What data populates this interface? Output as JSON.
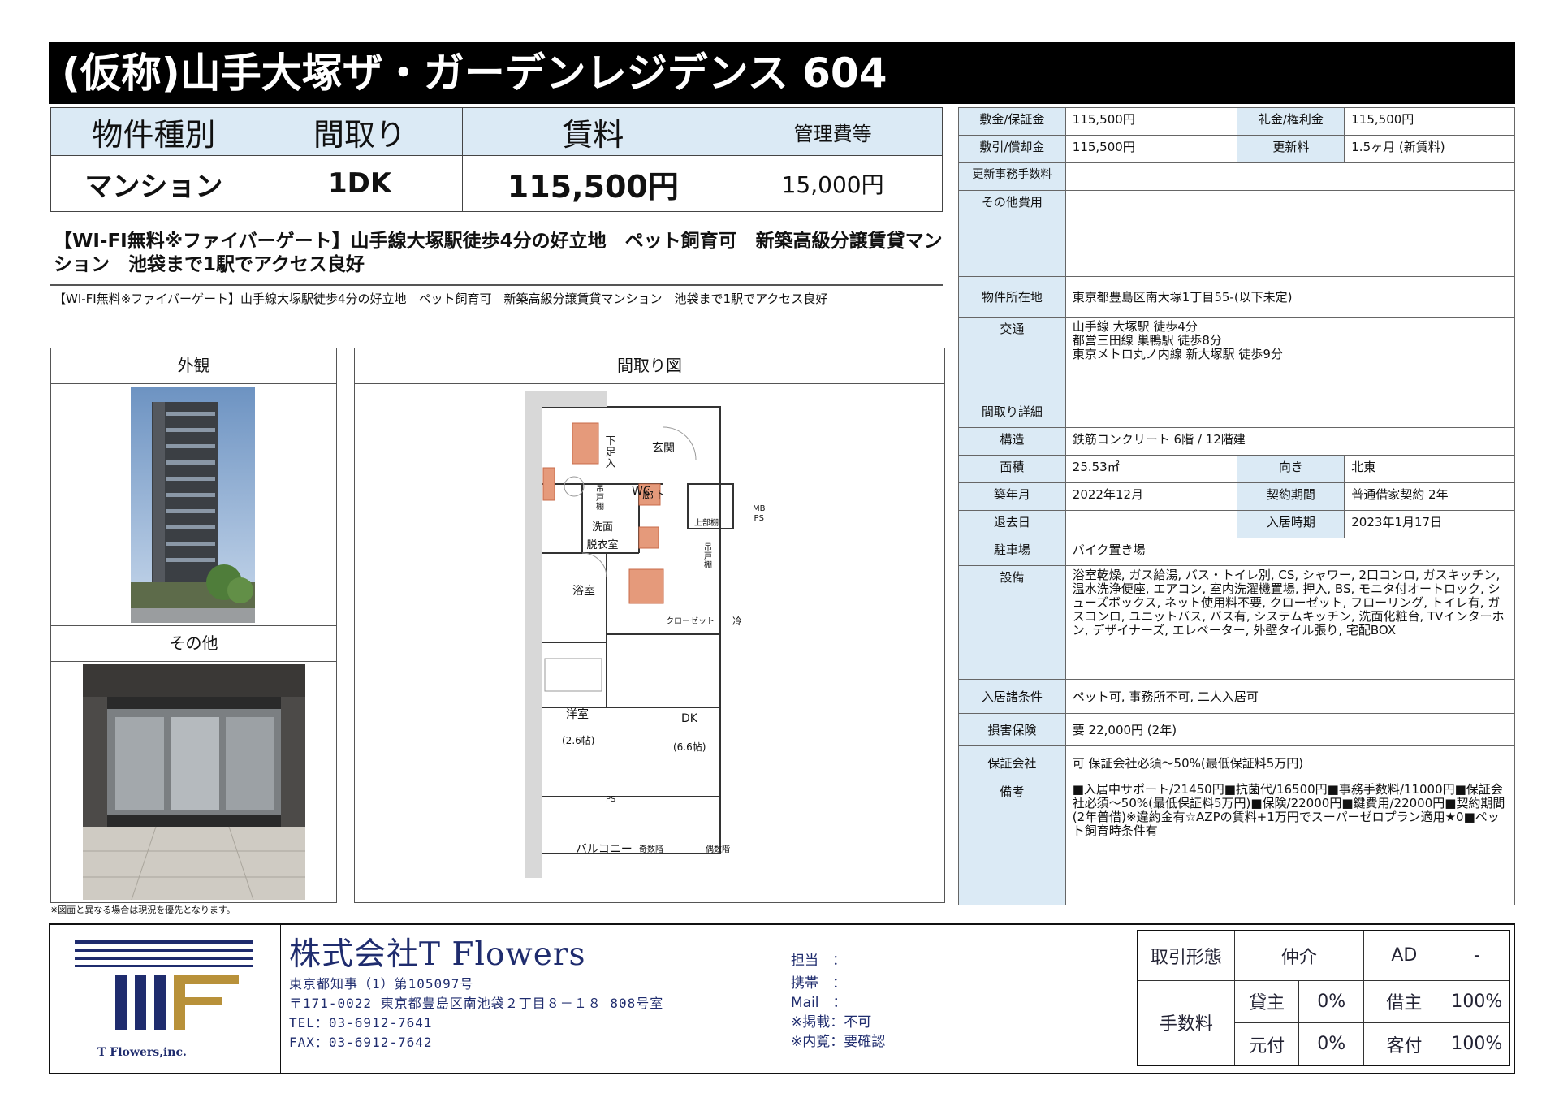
{
  "title": "(仮称)山手大塚ザ・ガーデンレジデンス 604",
  "summary": {
    "headers": [
      "物件種別",
      "間取り",
      "賃料",
      "管理費等"
    ],
    "values": [
      "マンション",
      "1DK",
      "115,500円",
      "15,000円"
    ]
  },
  "catch_copy": {
    "main": "【WI-FI無料※ファイバーゲート】山手線大塚駅徒歩4分の好立地　ペット飼育可　新築高級分譲賃貸マンション　池袋まで1駅でアクセス良好",
    "sub": "【WI-FI無料※ファイバーゲート】山手線大塚駅徒歩4分の好立地　ペット飼育可　新築高級分譲賃貸マンション　池袋まで1駅でアクセス良好"
  },
  "photos": {
    "exterior_label": "外観",
    "other_label": "その他",
    "floorplan_label": "間取り図"
  },
  "floorplan": {
    "rooms": {
      "shoes": "下足入",
      "entrance": "玄関",
      "wc": "WC",
      "hall": "廊下",
      "cabinet_left": "吊戸棚",
      "upper_cabinet": "上部棚",
      "mbps": "MB\nPS",
      "washroom": "洗面\n脱衣室",
      "cabinet_right": "吊戸棚",
      "bath": "浴室",
      "closet": "クローゼット",
      "fridge": "冷",
      "western": "洋室",
      "western_size": "(2.6帖)",
      "dk": "DK",
      "dk_size": "(6.6帖)",
      "ps": "PS",
      "balcony": "バルコニー",
      "odd_floor": "奇数階",
      "even_floor": "偶数階"
    }
  },
  "details": {
    "deposit_label": "敷金/保証金",
    "deposit": "115,500円",
    "key_money_label": "礼金/権利金",
    "key_money": "115,500円",
    "amortization_label": "敷引/償却金",
    "amortization": "115,500円",
    "renewal_label": "更新料",
    "renewal": "1.5ヶ月 (新賃料)",
    "renewal_fee_label": "更新事務手数料",
    "renewal_fee": "",
    "other_costs_label": "その他費用",
    "other_costs": "",
    "address_label": "物件所在地",
    "address": "東京都豊島区南大塚1丁目55-(以下未定)",
    "access_label": "交通",
    "access": [
      "山手線 大塚駅 徒歩4分",
      "都営三田線 巣鴨駅 徒歩8分",
      "東京メトロ丸ノ内線 新大塚駅 徒歩9分"
    ],
    "layout_detail_label": "間取り詳細",
    "layout_detail": "",
    "structure_label": "構造",
    "structure": "鉄筋コンクリート 6階 / 12階建",
    "area_label": "面積",
    "area": "25.53㎡",
    "direction_label": "向き",
    "direction": "北東",
    "built_label": "築年月",
    "built": "2022年12月",
    "contract_label": "契約期間",
    "contract": "普通借家契約 2年",
    "move_out_label": "退去日",
    "move_out": "",
    "move_in_label": "入居時期",
    "move_in": "2023年1月17日",
    "parking_label": "駐車場",
    "parking": "バイク置き場",
    "equipment_label": "設備",
    "equipment": "浴室乾燥, ガス給湯, バス・トイレ別, CS, シャワー, 2口コンロ, ガスキッチン, 温水洗浄便座, エアコン, 室内洗濯機置場, 押入, BS, モニタ付オートロック, シューズボックス, ネット使用料不要, クローゼット, フローリング, トイレ有, ガスコンロ, ユニットバス, バス有, システムキッチン, 洗面化粧台, TVインターホン, デザイナーズ, エレベーター, 外壁タイル張り, 宅配BOX",
    "conditions_label": "入居諸条件",
    "conditions": "ペット可, 事務所不可, 二人入居可",
    "insurance_label": "損害保険",
    "insurance": "要 22,000円 (2年)",
    "guarantor_label": "保証会社",
    "guarantor": "可 保証会社必須〜50%(最低保証料5万円)",
    "remarks_label": "備考",
    "remarks": "■入居中サポート/21450円■抗菌代/16500円■事務手数料/11000円■保証会社必須〜50%(最低保証料5万円)■保険/22000円■鍵費用/22000円■契約期間(2年普借)※違約金有☆AZPの賃料+1万円でスーパーゼロプラン適用★0■ペット飼育時条件有"
  },
  "note": "※図面と異なる場合は現況を優先となります。",
  "footer": {
    "logo_text": "T Flowers,inc.",
    "company": "株式会社T Flowers",
    "license": "東京都知事（1）第105097号",
    "address": "〒171-0022 東京都豊島区南池袋２丁目８－１８ 808号室",
    "tel": "TEL：03-6912-7641",
    "fax": "FAX：03-6912-7642",
    "contact": {
      "staff": "担当　：",
      "mobile": "携帯　：",
      "mail": "Mail　：",
      "publish": "※掲載：不可",
      "viewing": "※内覧：要確認"
    },
    "fees": {
      "transaction_label": "取引形態",
      "transaction": "仲介",
      "ad_label": "AD",
      "ad": "-",
      "commission_label": "手数料",
      "lender_label": "貸主",
      "lender": "0%",
      "tenant_label": "借主",
      "tenant": "100%",
      "source_label": "元付",
      "source": "0%",
      "client_label": "客付",
      "client": "100%"
    }
  },
  "colors": {
    "label_bg": "#dbeaf5",
    "title_bg": "#000000",
    "brand_navy": "#1f2c6e",
    "logo_gold": "#b8913a",
    "plan_accent": "#e59a7b"
  }
}
